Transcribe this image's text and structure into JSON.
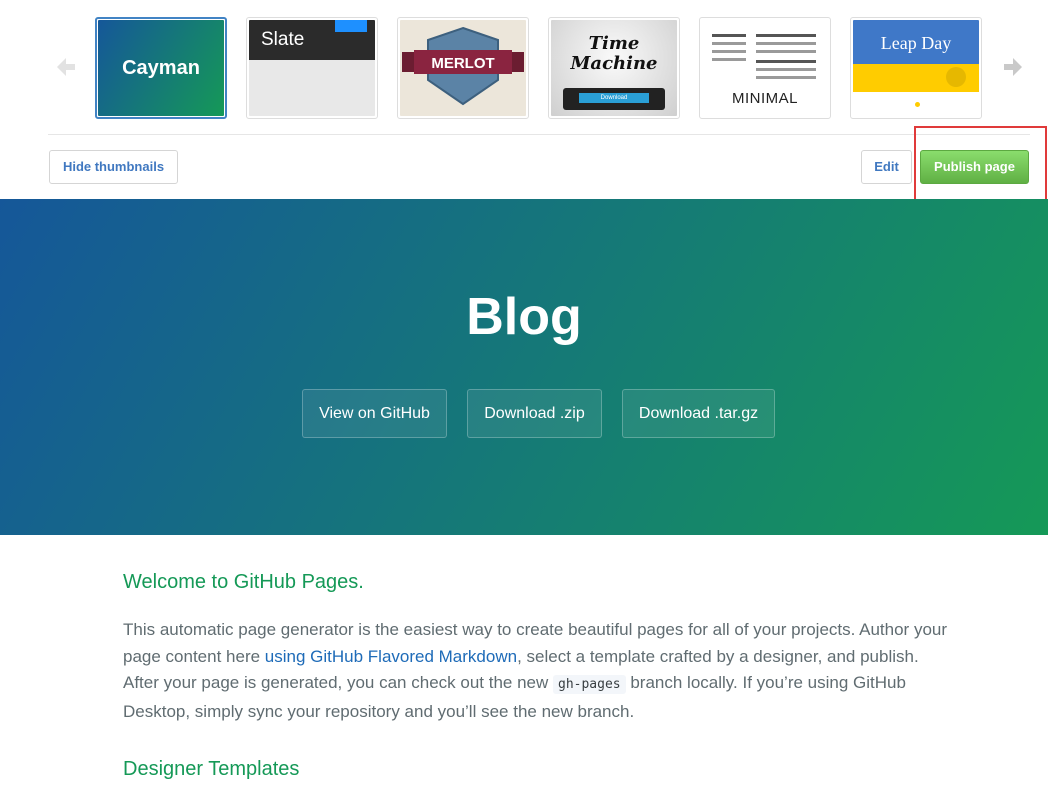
{
  "picker": {
    "prev_icon": "arrow-left-icon",
    "next_icon": "arrow-right-icon",
    "themes": [
      {
        "name": "Cayman",
        "selected": true
      },
      {
        "name": "Slate",
        "selected": false
      },
      {
        "name": "MERLOT",
        "selected": false
      },
      {
        "name": "Time Machine",
        "line1": "Time",
        "line2": "Machine",
        "download_label": "Download",
        "selected": false
      },
      {
        "name": "MINIMAL",
        "selected": false
      },
      {
        "name": "Leap Day",
        "selected": false
      }
    ],
    "hide_thumbnails_label": "Hide thumbnails",
    "edit_label": "Edit",
    "publish_label": "Publish page"
  },
  "hero": {
    "title": "Blog",
    "buttons": [
      "View on GitHub",
      "Download .zip",
      "Download .tar.gz"
    ]
  },
  "content": {
    "welcome_heading": "Welcome to GitHub Pages.",
    "para_part1": "This automatic page generator is the easiest way to create beautiful pages for all of your projects. Author your page content here ",
    "para_link": "using GitHub Flavored Markdown",
    "para_part2": ", select a template crafted by a designer, and publish. After your page is generated, you can check out the new ",
    "para_code": "gh-pages",
    "para_part3": " branch locally. If you’re using GitHub Desktop, simply sync your repository and you’ll see the new branch.",
    "designer_heading": "Designer Templates"
  },
  "colors": {
    "accent_green": "#159957",
    "accent_blue": "#155799",
    "publish_green": "#60b044",
    "link_blue": "#1e6bb8",
    "highlight_red": "#e03a3a"
  }
}
